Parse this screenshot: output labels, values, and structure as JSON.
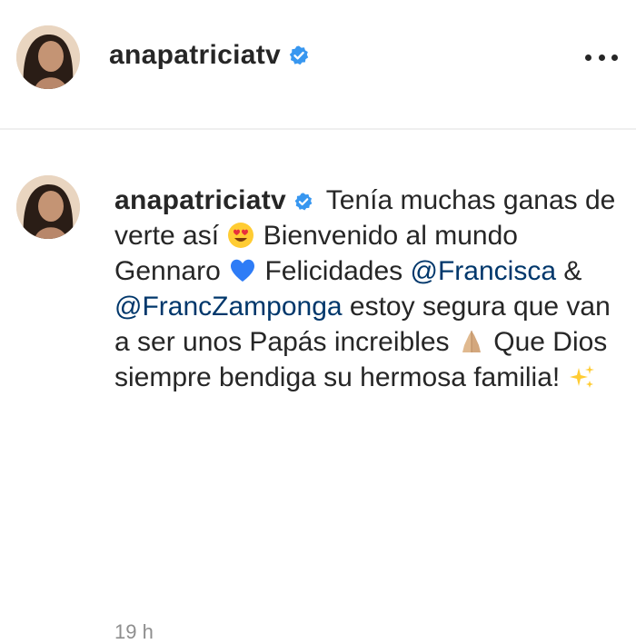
{
  "post_header": {
    "username": "anapatriciatv",
    "avatar_icon": "profile-photo",
    "verified_icon": "verified-badge-icon",
    "more_icon": "more-options-icon"
  },
  "comment": {
    "username": "anapatriciatv",
    "text_1": "Tenía muchas ganas de verte así",
    "emoji_1": "heart-eyes-emoji",
    "text_2": "Bienvenido al mundo Gennaro",
    "emoji_2": "blue-heart-emoji",
    "text_3": "Felicidades",
    "mention_1": "@Francisca",
    "text_4": "&",
    "mention_2": "@FrancZamponga",
    "text_5": "estoy segura que van a ser unos Papás increibles",
    "emoji_3": "folded-hands-emoji",
    "text_6": "Que Dios siempre bendiga su hermosa familia!",
    "emoji_4": "sparkles-emoji",
    "timestamp": "19 h"
  },
  "colors": {
    "text": "#262626",
    "mention": "#00376b",
    "verified": "#3897f0",
    "muted": "#8e8e8e"
  }
}
